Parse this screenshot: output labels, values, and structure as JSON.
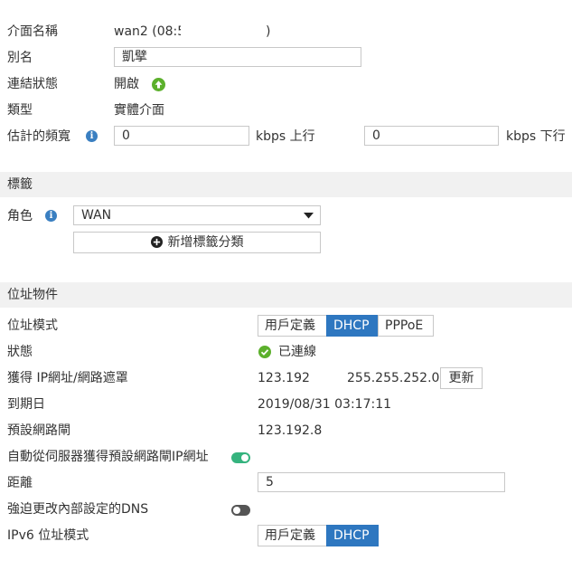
{
  "interface": {
    "name_label": "介面名稱",
    "name_value": "wan2 (08:5",
    "name_suffix": ")",
    "alias_label": "別名",
    "alias_value": "凱擘",
    "link_status_label": "連結狀態",
    "link_status_value": "開啟",
    "type_label": "類型",
    "type_value": "實體介面",
    "bandwidth_label": "估計的頻寬",
    "upstream_value": "0",
    "upstream_unit": "kbps 上行",
    "downstream_value": "0",
    "downstream_unit": "kbps 下行"
  },
  "tags": {
    "section_title": "標籤",
    "role_label": "角色",
    "role_value": "WAN",
    "add_tag_button": "新增標籤分類"
  },
  "address": {
    "section_title": "位址物件",
    "mode_label": "位址模式",
    "mode_options": [
      "用戶定義",
      "DHCP",
      "PPPoE"
    ],
    "mode_selected": "DHCP",
    "status_label": "狀態",
    "status_value": "已連線",
    "ip_label": "獲得 IP網址/網路遮罩",
    "ip_value": "123.192",
    "netmask_value": "255.255.252.0",
    "renew_button": "更新",
    "expiry_label": "到期日",
    "expiry_value": "2019/08/31 03:17:11",
    "gateway_label": "預設網路閘",
    "gateway_value": "123.192.8",
    "auto_gateway_label": "自動從伺服器獲得預設網路閘IP網址",
    "auto_gateway_enabled": true,
    "distance_label": "距離",
    "distance_value": "5",
    "override_dns_label": "強迫更改內部設定的DNS",
    "override_dns_enabled": false,
    "ipv6_mode_label": "IPv6 位址模式",
    "ipv6_mode_options": [
      "用戶定義",
      "DHCP"
    ],
    "ipv6_mode_selected": "DHCP"
  },
  "colors": {
    "accent": "#2e77c0",
    "status_green": "#35b37e",
    "link_up_green": "#5cb02c",
    "section_bg": "#f1f1f1"
  },
  "icons": {
    "link_up": "arrow-up-circle-icon",
    "info": "info-icon",
    "dropdown": "caret-down-icon",
    "add": "plus-circle-icon",
    "connected": "check-circle-icon"
  }
}
